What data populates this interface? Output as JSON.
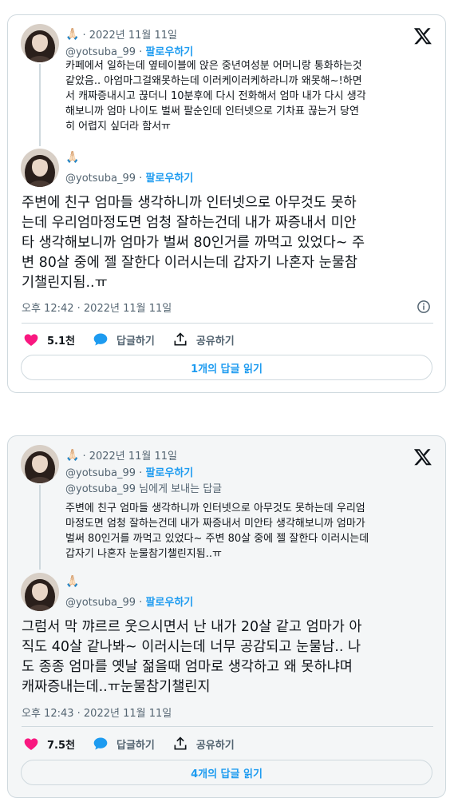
{
  "cards": [
    {
      "quoted": {
        "emoji": "🙏🏻",
        "date": "· 2022년 11월 11일",
        "handle": "@yotsuba_99",
        "follow": "팔로우하기",
        "text": "카페에서 일하는데 옆테이블에 앉은 중년여성분 어머니랑 통화하는것\n같았음.. 아엄마그걸왜못하는데 이러케이러케하라니까 왜못해~!하면\n서 캐짜증내시고 끊더니 10분후에 다시 전화해서 엄마 내가 다시 생각\n해보니까 엄마 나이도 벌써 팔순인데 인터넷으로 기차표 끊는거 당연\n히 어렵지 싶더라 함서ㅠ"
      },
      "author": {
        "emoji": "🙏🏻",
        "handle": "@yotsuba_99",
        "follow": "팔로우하기"
      },
      "text": "주변에 친구 엄마들 생각하니까 인터넷으로 아무것도 못하\n는데 우리엄마정도면 엄청 잘하는건데 내가 짜증내서 미안\n타 생각해보니까 엄마가 벌써 80인거를 까먹고 있었다~ 주\n변 80살 중에 젤 잘한다 이러시는데 갑자기 나혼자 눈물참\n기챌린지됨..ㅠ",
      "timestamp": "오후 12:42 · 2022년 11월 11일",
      "likes": "5.1천",
      "reply_label": "답글하기",
      "share_label": "공유하기",
      "read_replies": "1개의 답글 읽기"
    },
    {
      "quoted": {
        "emoji": "🙏🏻",
        "date": "· 2022년 11월 11일",
        "handle": "@yotsuba_99",
        "follow": "팔로우하기",
        "reply_to_handle": "@yotsuba_99",
        "reply_to_suffix": " 님에게 보내는 답글",
        "text": "주변에 친구 엄마들 생각하니까 인터넷으로 아무것도 못하는데 우리엄\n마정도면 엄청 잘하는건데 내가 짜증내서 미안타 생각해보니까 엄마가\n벌써 80인거를 까먹고 있었다~ 주변 80살 중에 젤 잘한다 이러시는데\n갑자기 나혼자 눈물참기챌린지됨..ㅠ"
      },
      "author": {
        "emoji": "🙏🏻",
        "handle": "@yotsuba_99",
        "follow": "팔로우하기"
      },
      "text": "그럼서 막 꺄르르 웃으시면서 난 내가 20살 같고 엄마가 아\n직도 40살 같나봐~ 이러시는데 너무 공감되고 눈물남.. 나\n도 종종 엄마를 옛날 젊을때 엄마로 생각하고 왜 못하냐며\n캐짜증내는데..ㅠ눈물참기챌린지",
      "timestamp": "오후 12:43 · 2022년 11월 11일",
      "likes": "7.5천",
      "reply_label": "답글하기",
      "share_label": "공유하기",
      "read_replies": "4개의 답글 읽기"
    }
  ],
  "colors": {
    "accent": "#1d9bf0",
    "like": "#f91880",
    "text": "#0f1419",
    "muted": "#536471",
    "border": "#cfd9de"
  },
  "icons": [
    "x-logo-icon",
    "info-icon",
    "heart-icon",
    "reply-bubble-icon",
    "share-icon"
  ]
}
